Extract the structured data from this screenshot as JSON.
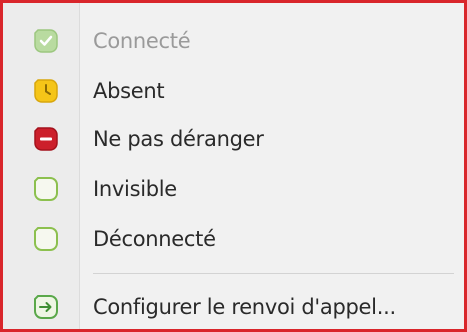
{
  "menu": {
    "items": [
      {
        "label": "Connecté",
        "icon": "status-online-icon",
        "color": "#7fbf5a",
        "disabled": true
      },
      {
        "label": "Absent",
        "icon": "status-away-icon",
        "color": "#f2c21b",
        "disabled": false
      },
      {
        "label": "Ne pas déranger",
        "icon": "status-dnd-icon",
        "color": "#c8202b",
        "disabled": false
      },
      {
        "label": "Invisible",
        "icon": "status-invisible-icon",
        "color": "#8cc04e",
        "disabled": false
      },
      {
        "label": "Déconnecté",
        "icon": "status-offline-icon",
        "color": "#8cc04e",
        "disabled": false
      },
      {
        "label": "Configurer le renvoi d'appel...",
        "icon": "call-forward-icon",
        "color": "#5aa84a",
        "disabled": false
      }
    ]
  },
  "frame_color": "#d9262b"
}
